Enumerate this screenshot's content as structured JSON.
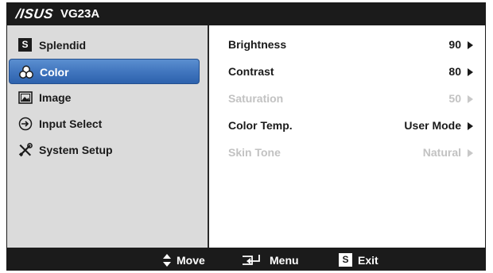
{
  "header": {
    "brand": "/ISUS",
    "model": "VG23A"
  },
  "sidebar": {
    "items": [
      {
        "label": "Splendid",
        "icon": "splendid-s-icon",
        "icon_text": "S"
      },
      {
        "label": "Color",
        "icon": "color-circles-icon",
        "selected": true
      },
      {
        "label": "Image",
        "icon": "image-icon"
      },
      {
        "label": "Input Select",
        "icon": "input-select-icon"
      },
      {
        "label": "System Setup",
        "icon": "wrench-screwdriver-icon"
      }
    ]
  },
  "settings": [
    {
      "name": "Brightness",
      "value": "90",
      "enabled": true
    },
    {
      "name": "Contrast",
      "value": "80",
      "enabled": true
    },
    {
      "name": "Saturation",
      "value": "50",
      "enabled": false
    },
    {
      "name": "Color Temp.",
      "value": "User Mode",
      "enabled": true
    },
    {
      "name": "Skin Tone",
      "value": "Natural",
      "enabled": false
    }
  ],
  "footer": {
    "move_label": "Move",
    "menu_label": "Menu",
    "exit_label": "Exit",
    "exit_icon_text": "S"
  },
  "colors": {
    "bar": "#1b1b1b",
    "sidebar_bg": "#dbdbdb",
    "selection": "#3f74bd",
    "disabled_text": "#c2c2c2"
  }
}
